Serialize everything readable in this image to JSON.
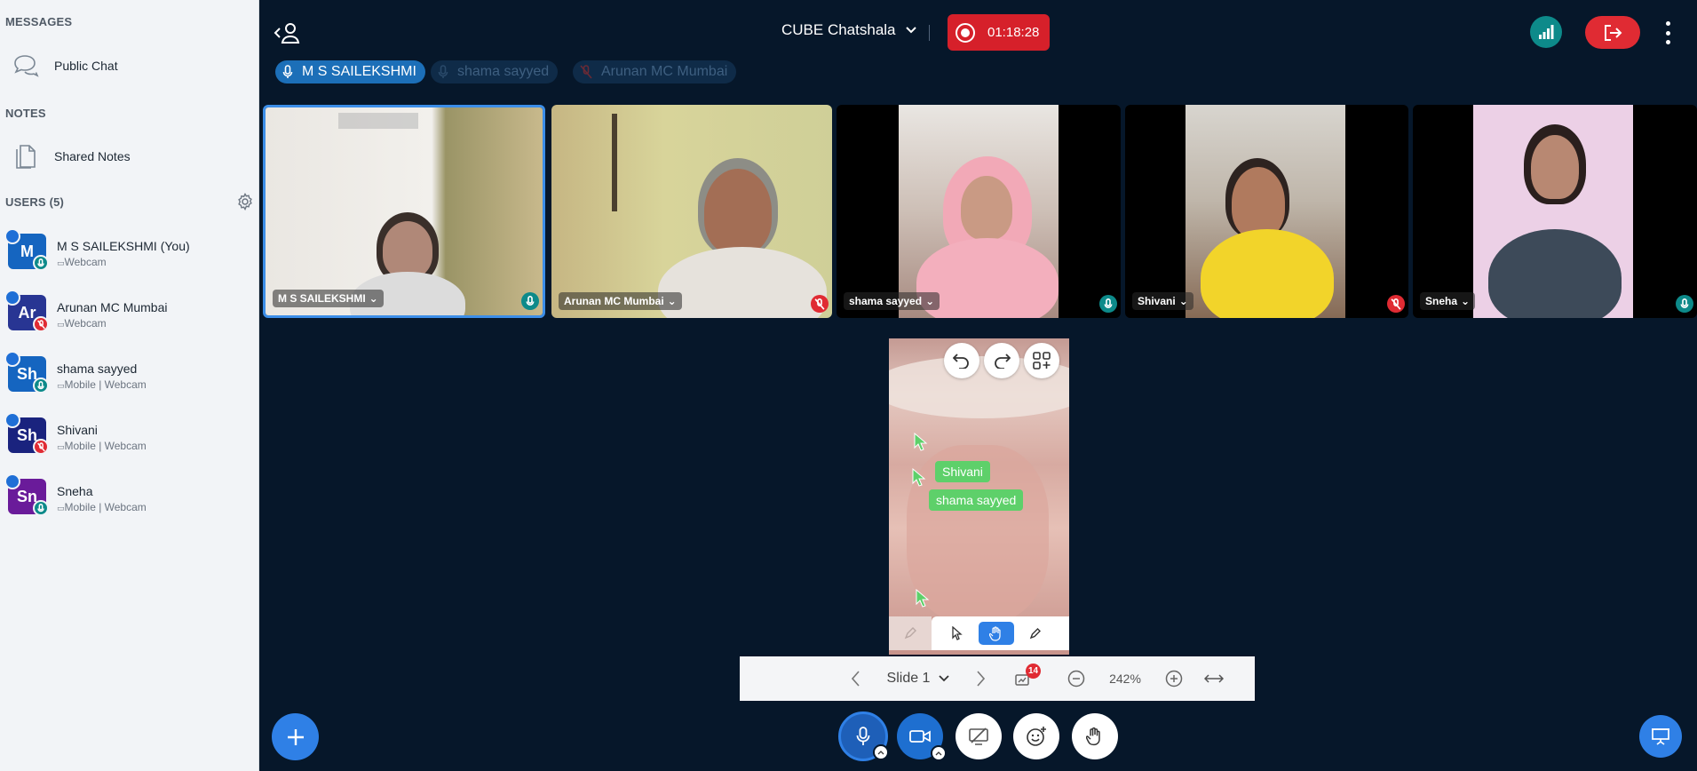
{
  "sidebar": {
    "messages_title": "MESSAGES",
    "public_chat": "Public Chat",
    "notes_title": "NOTES",
    "shared_notes": "Shared Notes",
    "users_title": "USERS (5)",
    "users": [
      {
        "initials": "M",
        "name": "M S SAILEKSHMI (You)",
        "status": "Webcam",
        "color": "#1565c0",
        "audio": "mic-on"
      },
      {
        "initials": "Ar",
        "name": "Arunan MC Mumbai",
        "status": "Webcam",
        "color": "#283593",
        "audio": "mic-muted"
      },
      {
        "initials": "Sh",
        "name": "shama sayyed",
        "status": "Mobile | Webcam",
        "color": "#1565c0",
        "audio": "mic-on"
      },
      {
        "initials": "Sh",
        "name": "Shivani",
        "status": "Mobile | Webcam",
        "color": "#1a237e",
        "audio": "mic-muted"
      },
      {
        "initials": "Sn",
        "name": "Sneha",
        "status": "Mobile | Webcam",
        "color": "#6a1b9a",
        "audio": "mic-on"
      }
    ]
  },
  "topbar": {
    "meeting_title": "CUBE Chatshala",
    "recording_time": "01:18:28"
  },
  "talkers": [
    {
      "name": "M S SAILEKSHMI",
      "state": "active"
    },
    {
      "name": "shama sayyed",
      "state": "inactive"
    },
    {
      "name": "Arunan MC Mumbai",
      "state": "inactive-muted"
    }
  ],
  "videos": [
    {
      "name": "M S SAILEKSHMI",
      "audio": "mic-on"
    },
    {
      "name": "Arunan MC Mumbai",
      "audio": "mic-muted"
    },
    {
      "name": "shama sayyed",
      "audio": "mic-on"
    },
    {
      "name": "Shivani",
      "audio": "mic-muted"
    },
    {
      "name": "Sneha",
      "audio": "mic-on"
    }
  ],
  "whiteboard": {
    "cursor_labels": [
      "Shivani",
      "shama sayyed"
    ]
  },
  "slidebar": {
    "slide_label": "Slide 1",
    "notification_count": "14",
    "zoom": "242%"
  },
  "colors": {
    "background": "#06172a",
    "sidebar": "#f2f4f7",
    "accent_blue": "#1f6fd6",
    "recording_red": "#d6202a",
    "mic_on": "#0d8a8a",
    "mic_muted": "#e02b33"
  }
}
